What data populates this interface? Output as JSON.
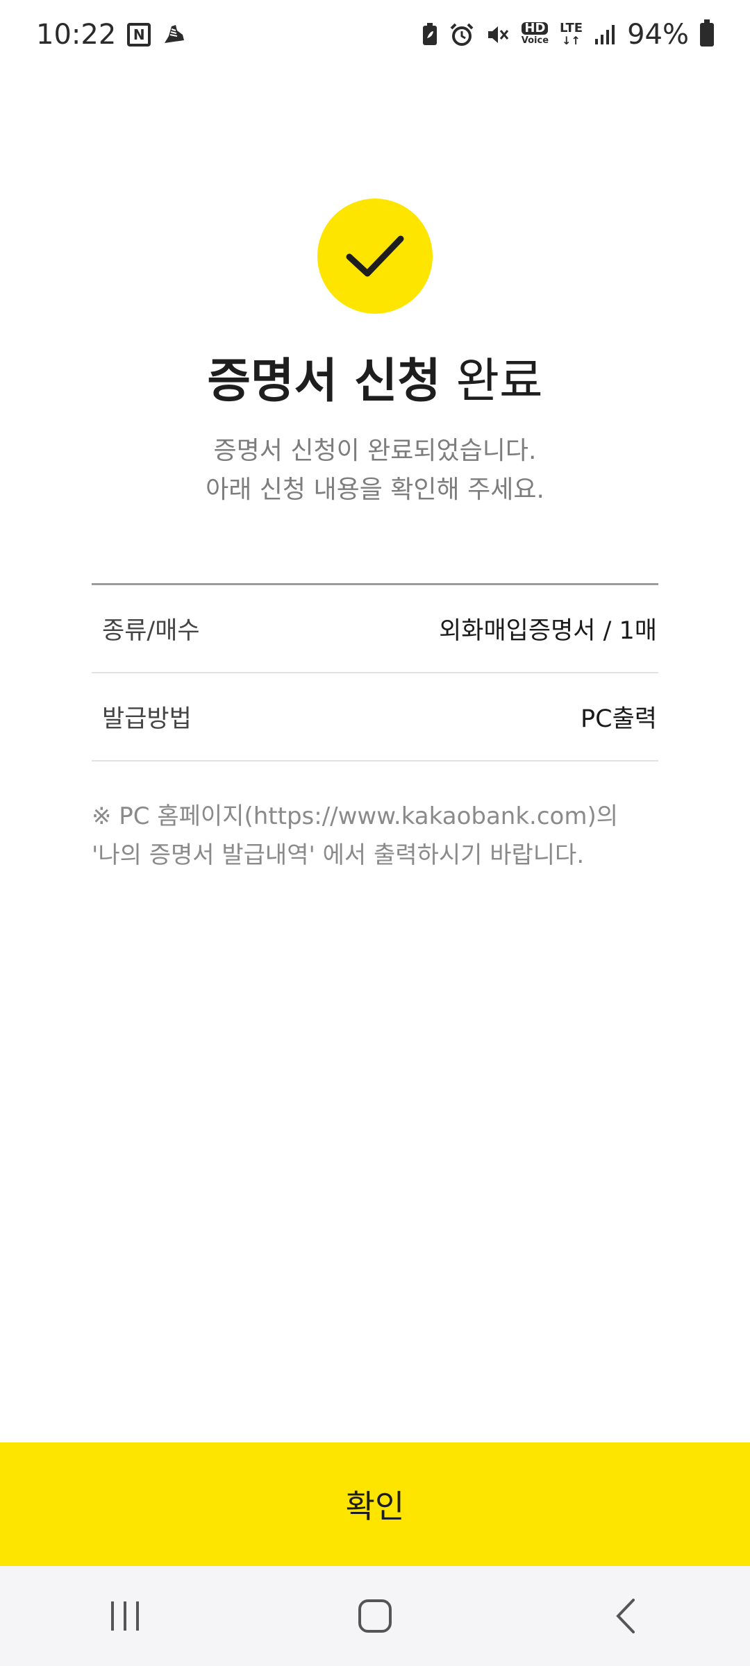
{
  "status_bar": {
    "time": "10:22",
    "calendar_badge": "N",
    "hd_voice_top": "HD",
    "hd_voice_bottom": "Voice",
    "lte": "LTE",
    "battery_percent": "94%"
  },
  "header": {
    "title_bold": "증명서 신청",
    "title_regular": "완료",
    "subtitle_line1": "증명서 신청이 완료되었습니다.",
    "subtitle_line2": "아래 신청 내용을 확인해 주세요."
  },
  "details": {
    "rows": [
      {
        "label": "종류/매수",
        "value": "외화매입증명서 / 1매"
      },
      {
        "label": "발급방법",
        "value": "PC출력"
      }
    ]
  },
  "notice": {
    "line1": "※ PC 홈페이지(https://www.kakaobank.com)의",
    "line2": "'나의 증명서 발급내역' 에서 출력하시기 바랍니다."
  },
  "confirm_button": {
    "label": "확인"
  },
  "colors": {
    "accent": "#FEE500",
    "text_primary": "#1e1e1e",
    "text_secondary": "#7d7d7d",
    "nav_background": "#f5f5f7"
  }
}
